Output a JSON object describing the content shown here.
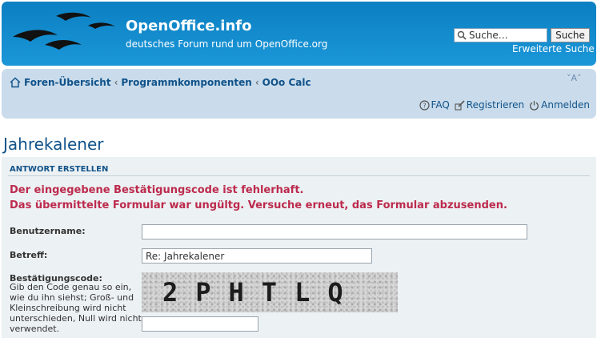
{
  "header": {
    "site_title": "OpenOffice.info",
    "site_description": "deutsches Forum rund um OpenOffice.org",
    "search_placeholder": "Suche…",
    "search_button": "Suche",
    "advanced_search": "Erweiterte Suche",
    "bg_color": "#0b7fc2"
  },
  "nav": {
    "breadcrumbs": [
      "Foren-Übersicht",
      "Programmkomponenten",
      "OOo Calc"
    ],
    "font_size_toggle": "˅A˄",
    "links": {
      "faq": "FAQ",
      "register": "Registrieren",
      "login": "Anmelden"
    },
    "bg_color": "#cadceb"
  },
  "page": {
    "title": "Jahrekalener"
  },
  "form": {
    "heading": "ANTWORT ERSTELLEN",
    "error_line1": "Der eingegebene Bestätigungscode ist fehlerhaft.",
    "error_line2": "Das übermittelte Formular war ungültg. Versuche erneut, das Formular abzusenden.",
    "error_color": "#bc2a4d",
    "username_label": "Benutzername:",
    "username_value": "",
    "subject_label": "Betreff:",
    "subject_value": "Re: Jahrekalener",
    "captcha_label": "Bestätigungscode:",
    "captcha_help": "Gib den Code genau so ein, wie du ihn siehst; Groß- und Kleinschreibung wird nicht unterschieden, Null wird nicht verwendet.",
    "captcha_text": "2PHTLQ",
    "captcha_value": ""
  }
}
